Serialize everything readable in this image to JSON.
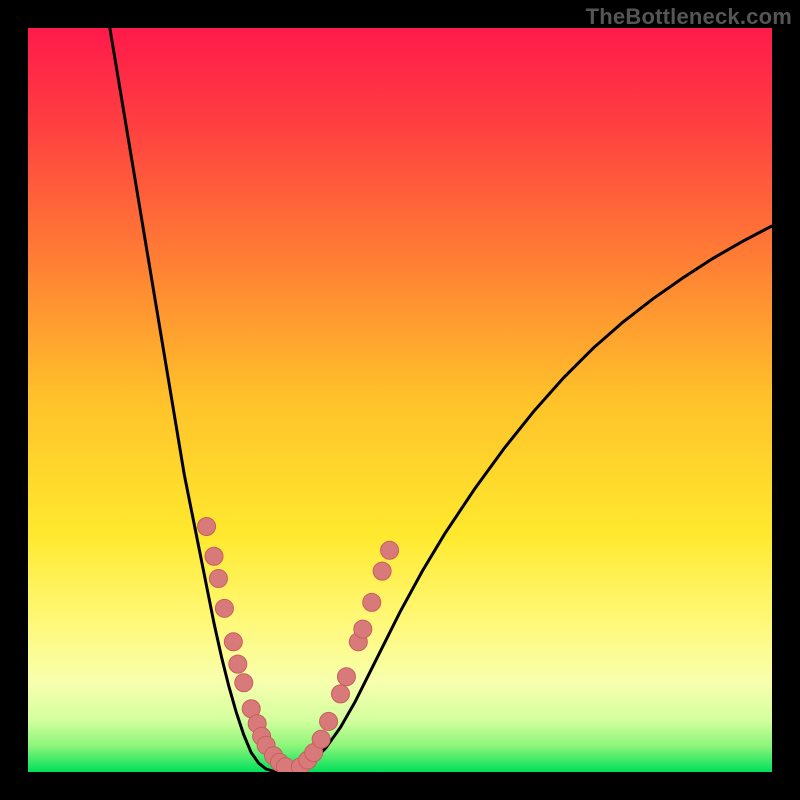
{
  "watermark": "TheBottleneck.com",
  "colors": {
    "frame": "#000000",
    "gradient_stops": [
      {
        "offset": 0.0,
        "color": "#ff1a4b"
      },
      {
        "offset": 0.12,
        "color": "#ff3c42"
      },
      {
        "offset": 0.3,
        "color": "#ff7a35"
      },
      {
        "offset": 0.5,
        "color": "#ffc22a"
      },
      {
        "offset": 0.68,
        "color": "#ffe92e"
      },
      {
        "offset": 0.8,
        "color": "#fff97a"
      },
      {
        "offset": 0.88,
        "color": "#f7ffae"
      },
      {
        "offset": 0.93,
        "color": "#d4ff9e"
      },
      {
        "offset": 0.965,
        "color": "#8cf57a"
      },
      {
        "offset": 1.0,
        "color": "#00e05a"
      }
    ],
    "curve": "#000000",
    "marker_fill": "#d97a7a",
    "marker_stroke": "#c85e5e"
  },
  "chart_data": {
    "type": "line",
    "title": "",
    "xlabel": "",
    "ylabel": "",
    "xlim": [
      0,
      100
    ],
    "ylim": [
      0,
      100
    ],
    "series": [
      {
        "name": "curve",
        "x": [
          11,
          12,
          13,
          14,
          15,
          16,
          17,
          18,
          19,
          20,
          21,
          22,
          23,
          24,
          25,
          26,
          27,
          28,
          29,
          30,
          31,
          32,
          33,
          34,
          35,
          36,
          38,
          40,
          42,
          44,
          46,
          48,
          50,
          53,
          56,
          60,
          64,
          68,
          72,
          76,
          80,
          84,
          88,
          92,
          96,
          100
        ],
        "y": [
          100,
          94,
          88,
          82,
          76,
          70,
          64,
          58,
          52,
          46,
          40,
          35,
          30,
          25,
          20,
          15.5,
          11.5,
          8,
          5,
          2.6,
          1.2,
          0.4,
          0.1,
          0,
          0,
          0.2,
          1.2,
          3.2,
          6,
          9.5,
          13.5,
          17.5,
          21.5,
          27,
          32,
          38,
          43.5,
          48.5,
          53,
          57,
          60.5,
          63.6,
          66.4,
          69,
          71.3,
          73.4
        ]
      }
    ],
    "markers_left": [
      {
        "x": 24.0,
        "y": 33.0
      },
      {
        "x": 25.0,
        "y": 29.0
      },
      {
        "x": 25.6,
        "y": 26.0
      },
      {
        "x": 26.4,
        "y": 22.0
      },
      {
        "x": 27.6,
        "y": 17.5
      },
      {
        "x": 28.2,
        "y": 14.5
      },
      {
        "x": 29.0,
        "y": 12.0
      },
      {
        "x": 30.0,
        "y": 8.5
      },
      {
        "x": 30.8,
        "y": 6.5
      },
      {
        "x": 31.4,
        "y": 4.8
      },
      {
        "x": 32.0,
        "y": 3.6
      },
      {
        "x": 33.0,
        "y": 2.2
      },
      {
        "x": 33.8,
        "y": 1.3
      },
      {
        "x": 34.6,
        "y": 0.7
      }
    ],
    "markers_right": [
      {
        "x": 36.6,
        "y": 0.7
      },
      {
        "x": 37.6,
        "y": 1.6
      },
      {
        "x": 38.4,
        "y": 2.6
      },
      {
        "x": 39.4,
        "y": 4.4
      },
      {
        "x": 40.4,
        "y": 6.8
      },
      {
        "x": 42.0,
        "y": 10.5
      },
      {
        "x": 42.8,
        "y": 12.8
      },
      {
        "x": 44.4,
        "y": 17.5
      },
      {
        "x": 45.0,
        "y": 19.2
      },
      {
        "x": 46.2,
        "y": 22.8
      },
      {
        "x": 47.6,
        "y": 27.0
      },
      {
        "x": 48.6,
        "y": 29.8
      }
    ],
    "marker_radius": 9
  }
}
